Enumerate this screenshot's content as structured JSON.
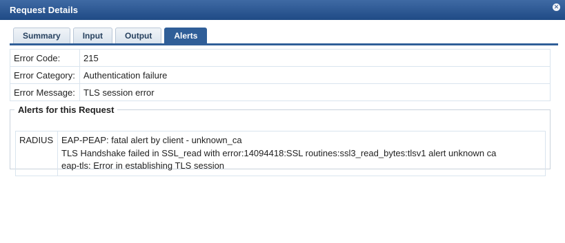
{
  "window": {
    "title": "Request Details",
    "close_glyph": "✕",
    "close_icon": "close-icon"
  },
  "tabs": [
    {
      "label": "Summary",
      "active": false
    },
    {
      "label": "Input",
      "active": false
    },
    {
      "label": "Output",
      "active": false
    },
    {
      "label": "Alerts",
      "active": true
    }
  ],
  "details": [
    {
      "label": "Error Code:",
      "value": "215"
    },
    {
      "label": "Error Category:",
      "value": "Authentication failure"
    },
    {
      "label": "Error Message:",
      "value": "TLS session error"
    }
  ],
  "alerts_section": {
    "legend": "Alerts for this Request",
    "rows": [
      {
        "source": "RADIUS",
        "messages": [
          "EAP-PEAP: fatal alert by client - unknown_ca",
          "TLS Handshake failed in SSL_read with error:14094418:SSL routines:ssl3_read_bytes:tlsv1 alert unknown ca",
          "eap-tls: Error in establishing TLS session"
        ]
      }
    ]
  },
  "colors": {
    "titlebar": "#2f5e98",
    "tab_active": "#2f5e98",
    "border": "#d9e4ee"
  }
}
